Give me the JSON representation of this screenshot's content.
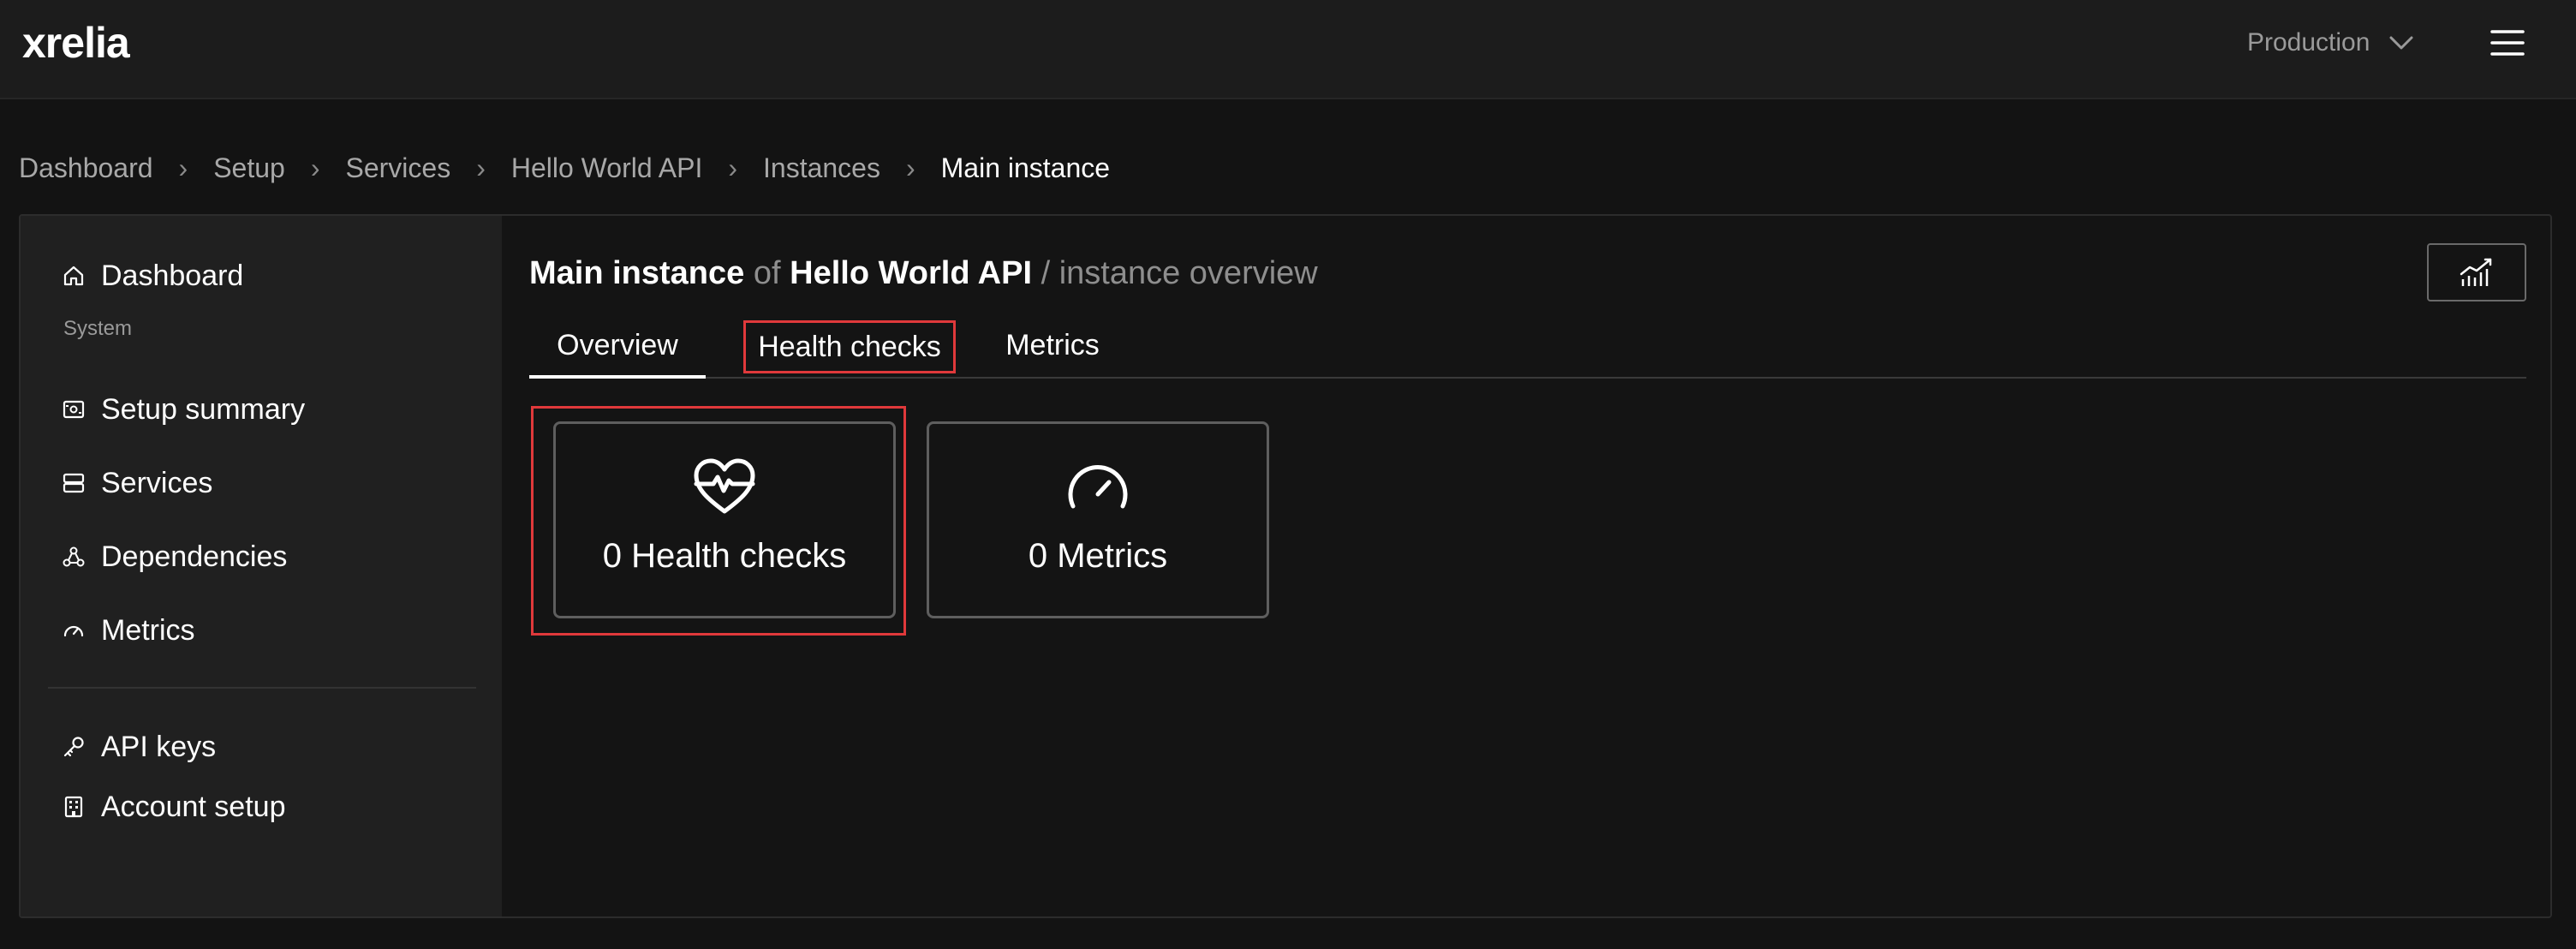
{
  "app": {
    "logo": "xrelia",
    "environment": "Production"
  },
  "breadcrumb": [
    {
      "label": "Dashboard"
    },
    {
      "label": "Setup"
    },
    {
      "label": "Services"
    },
    {
      "label": "Hello World API"
    },
    {
      "label": "Instances"
    },
    {
      "label": "Main instance"
    }
  ],
  "breadcrumb_separator": "›",
  "sidebar": {
    "dashboard": "Dashboard",
    "section_system": "System",
    "items": [
      {
        "label": "Setup summary",
        "icon": "setup-summary-icon"
      },
      {
        "label": "Services",
        "icon": "services-icon"
      },
      {
        "label": "Dependencies",
        "icon": "dependencies-icon"
      },
      {
        "label": "Metrics",
        "icon": "gauge-icon"
      }
    ],
    "bottom_items": [
      {
        "label": "API keys",
        "icon": "key-icon"
      },
      {
        "label": "Account setup",
        "icon": "building-icon"
      }
    ]
  },
  "page": {
    "instance_name": "Main instance",
    "of_text": "of",
    "service_name": "Hello World API",
    "suffix": "/ instance overview"
  },
  "tabs": [
    {
      "label": "Overview",
      "active": true
    },
    {
      "label": "Health checks",
      "highlighted": true
    },
    {
      "label": "Metrics"
    }
  ],
  "cards": {
    "health": {
      "label": "0 Health checks",
      "count": 0,
      "icon": "heart-pulse-icon"
    },
    "metrics": {
      "label": "0 Metrics",
      "count": 0,
      "icon": "gauge-icon"
    }
  },
  "colors": {
    "background": "#131313",
    "sidebar": "#202020",
    "highlight": "#e0393b",
    "muted_text": "#8e8e8e"
  }
}
